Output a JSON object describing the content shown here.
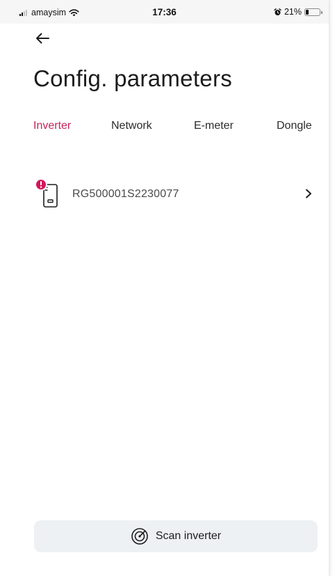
{
  "status_bar": {
    "carrier": "amaysim",
    "time": "17:36",
    "battery_percent": "21%",
    "battery_level": 0.21,
    "icons": [
      "signal-icon",
      "wifi-icon",
      "alarm-icon",
      "battery-icon"
    ]
  },
  "header": {
    "back_icon": "arrow-left-icon",
    "title": "Config. parameters"
  },
  "tabs": [
    {
      "label": "Inverter",
      "active": true
    },
    {
      "label": "Network",
      "active": false
    },
    {
      "label": "E-meter",
      "active": false
    },
    {
      "label": "Dongle",
      "active": false
    }
  ],
  "devices": [
    {
      "serial": "RG500001S2230077",
      "icon": "inverter-icon",
      "alert": "alert-icon",
      "chevron": "chevron-right-icon"
    }
  ],
  "footer": {
    "scan_label": "Scan inverter",
    "scan_icon": "radar-scan-icon"
  },
  "colors": {
    "accent": "#c8245a",
    "alert": "#d4165a",
    "button_bg": "#eef1f4",
    "text": "#1c1c1c"
  }
}
